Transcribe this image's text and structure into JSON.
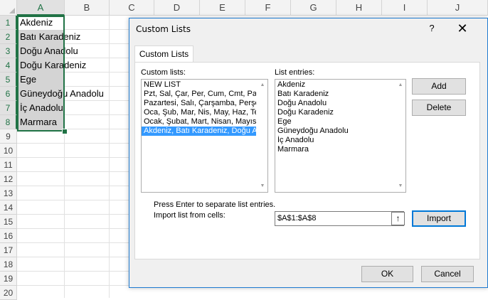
{
  "sheet": {
    "columns": [
      "A",
      "B",
      "C",
      "D",
      "E",
      "F",
      "G",
      "H",
      "I",
      "J"
    ],
    "rows": [
      "1",
      "2",
      "3",
      "4",
      "5",
      "6",
      "7",
      "8",
      "9",
      "10",
      "11",
      "12",
      "13",
      "14",
      "15",
      "16",
      "17",
      "18",
      "19",
      "20"
    ],
    "cells_a": [
      "Akdeniz",
      "Batı Karadeniz",
      "Doğu Anadolu",
      "Doğu Karadeniz",
      "Ege",
      "Güneydoğu Anadolu",
      "İç Anadolu",
      "Marmara"
    ]
  },
  "dialog": {
    "title": "Custom Lists",
    "help": "?",
    "close": "✕",
    "tab": "Custom Lists",
    "custom_lists_label": "Custom lists:",
    "list_entries_label": "List entries:",
    "custom_lists": [
      "NEW LIST",
      "Pzt, Sal, Çar, Per, Cum, Cmt, Paz",
      "Pazartesi, Salı, Çarşamba, Perşembe",
      "Oca, Şub, Mar, Nis, May, Haz, Tem",
      "Ocak, Şubat, Mart, Nisan, Mayıs",
      "Akdeniz, Batı Karadeniz, Doğu Anadolu"
    ],
    "list_entries": [
      "Akdeniz",
      "Batı Karadeniz",
      "Doğu Anadolu",
      "Doğu Karadeniz",
      "Ege",
      "Güneydoğu Anadolu",
      "İç Anadolu",
      "Marmara"
    ],
    "add_button": "Add",
    "delete_button": "Delete",
    "hint": "Press Enter to separate list entries.",
    "import_label": "Import list from cells:",
    "import_range": "$A$1:$A$8",
    "collapse_icon": "↑",
    "import_button": "Import",
    "ok_button": "OK",
    "cancel_button": "Cancel"
  },
  "colors": {
    "accent": "#217346",
    "selection": "#3399ff",
    "dialog_border": "#1f7bd1"
  }
}
